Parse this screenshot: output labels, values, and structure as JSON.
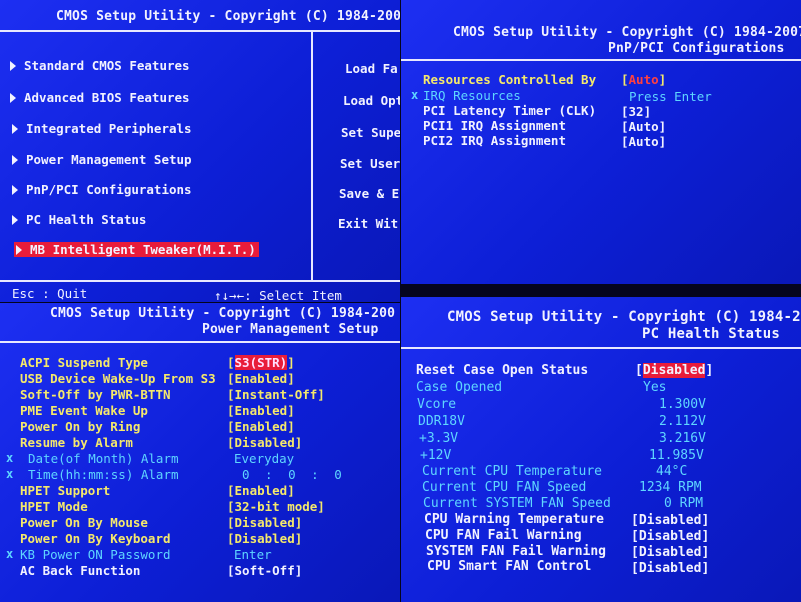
{
  "main": {
    "title": "CMOS Setup Utility - Copyright (C) 1984-200",
    "left_menu": [
      "Standard CMOS Features",
      "Advanced BIOS Features",
      "Integrated Peripherals",
      "Power Management Setup",
      "PnP/PCI Configurations",
      "PC Health Status",
      "MB Intelligent Tweaker(M.I.T.)"
    ],
    "right_menu": [
      "Load Fa",
      "Load Opt",
      "Set Supe",
      "Set User",
      "Save & E",
      "Exit Wit"
    ],
    "footer_left": "Esc : Quit",
    "footer_right": "↑↓→←: Select Item"
  },
  "pnp": {
    "title": "CMOS Setup Utility - Copyright (C) 1984-2007",
    "subtitle": "PnP/PCI Configurations",
    "rows": [
      {
        "label": "Resources Controlled By",
        "value": "[Auto]"
      },
      {
        "label": "IRQ Resources",
        "value": "Press Enter"
      },
      {
        "label": "PCI Latency Timer (CLK)",
        "value": "[32]"
      },
      {
        "label": "PCI1 IRQ Assignment",
        "value": "[Auto]"
      },
      {
        "label": "PCI2 IRQ Assignment",
        "value": "[Auto]"
      }
    ]
  },
  "power": {
    "title": "CMOS Setup Utility - Copyright (C) 1984-200",
    "subtitle": "Power Management Setup",
    "rows": [
      {
        "label": "ACPI Suspend Type",
        "value": "[S3(STR)]"
      },
      {
        "label": "USB Device Wake-Up From S3",
        "value": "[Enabled]"
      },
      {
        "label": "Soft-Off by PWR-BTTN",
        "value": "[Instant-Off]"
      },
      {
        "label": "PME Event Wake Up",
        "value": "[Enabled]"
      },
      {
        "label": "Power On by Ring",
        "value": "[Enabled]"
      },
      {
        "label": "Resume by Alarm",
        "value": "[Disabled]"
      },
      {
        "label": "Date(of Month) Alarm",
        "value": "Everyday"
      },
      {
        "label": "Time(hh:mm:ss) Alarm",
        "value": "0 : 0 : 0"
      },
      {
        "label": "HPET Support",
        "value": "[Enabled]"
      },
      {
        "label": "HPET Mode",
        "value": "[32-bit mode]"
      },
      {
        "label": "Power On By Mouse",
        "value": "[Disabled]"
      },
      {
        "label": "Power On By Keyboard",
        "value": "[Disabled]"
      },
      {
        "label": "KB Power ON Password",
        "value": "Enter"
      },
      {
        "label": "AC Back Function",
        "value": "[Soft-Off]"
      }
    ]
  },
  "health": {
    "title": "CMOS Setup Utility - Copyright (C) 1984-2",
    "subtitle": "PC Health Status",
    "rows": [
      {
        "label": "Reset Case Open Status",
        "value": "[Disabled]"
      },
      {
        "label": "Case Opened",
        "value": "Yes"
      },
      {
        "label": "Vcore",
        "value": "1.300V"
      },
      {
        "label": "DDR18V",
        "value": "2.112V"
      },
      {
        "label": "+3.3V",
        "value": "3.216V"
      },
      {
        "label": "+12V",
        "value": "11.985V"
      },
      {
        "label": "Current CPU Temperature",
        "value": "44°C"
      },
      {
        "label": "Current CPU FAN Speed",
        "value": "1234 RPM"
      },
      {
        "label": "Current SYSTEM FAN Speed",
        "value": "0 RPM"
      },
      {
        "label": "CPU Warning Temperature",
        "value": "[Disabled]"
      },
      {
        "label": "CPU FAN Fail Warning",
        "value": "[Disabled]"
      },
      {
        "label": "SYSTEM FAN Fail Warning",
        "value": "[Disabled]"
      },
      {
        "label": "CPU Smart FAN Control",
        "value": "[Disabled]"
      }
    ]
  }
}
